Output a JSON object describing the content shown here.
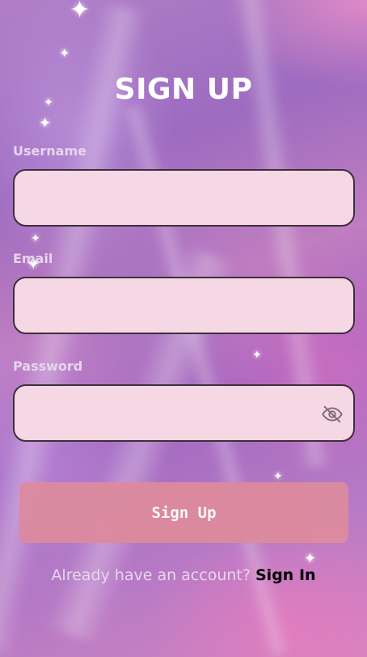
{
  "page": {
    "title": "SIGN UP"
  },
  "form": {
    "username": {
      "label": "Username",
      "value": "",
      "placeholder": ""
    },
    "email": {
      "label": "Email",
      "value": "",
      "placeholder": ""
    },
    "password": {
      "label": "Password",
      "value": "",
      "placeholder": "",
      "visibility_icon": "eye-off-icon"
    },
    "submit_label": "Sign Up"
  },
  "footer": {
    "prompt": "Already have an account?",
    "link_label": "Sign In"
  },
  "colors": {
    "field_background": "#f6d7e4",
    "field_border": "#3c2f3c",
    "button_background": "#dc8a9e",
    "label_color": "#e6d6ec",
    "link_color": "#000000"
  }
}
